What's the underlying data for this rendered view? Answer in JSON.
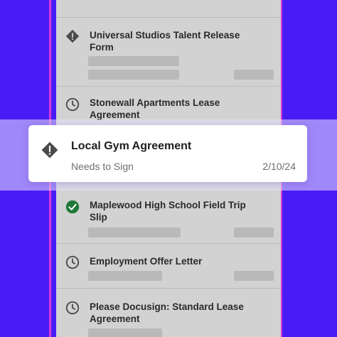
{
  "agreements": [
    {
      "title_line1": "Universal Studios Talent Release",
      "title_line2": "Form",
      "icon": "warning-icon"
    },
    {
      "title_line1": "Stonewall Apartments Lease",
      "title_line2": "Agreement",
      "icon": "clock-icon"
    },
    {
      "title_line1": "Maplewood High School Field Trip",
      "title_line2": "Slip",
      "icon": "check-circle-icon"
    },
    {
      "title_line1": "Employment Offer Letter",
      "title_line2": "",
      "icon": "clock-icon"
    },
    {
      "title_line1": "Please Docusign: Standard Lease",
      "title_line2": "Agreement",
      "icon": "clock-icon"
    }
  ],
  "highlight": {
    "title": "Local Gym Agreement",
    "status": "Needs to Sign",
    "date": "2/10/24",
    "icon": "warning-icon"
  },
  "colors": {
    "background": "#4a1cf5",
    "accent_glow": "#d63ad8",
    "completed": "#1f7a3a",
    "icon": "#4a4a4a"
  }
}
